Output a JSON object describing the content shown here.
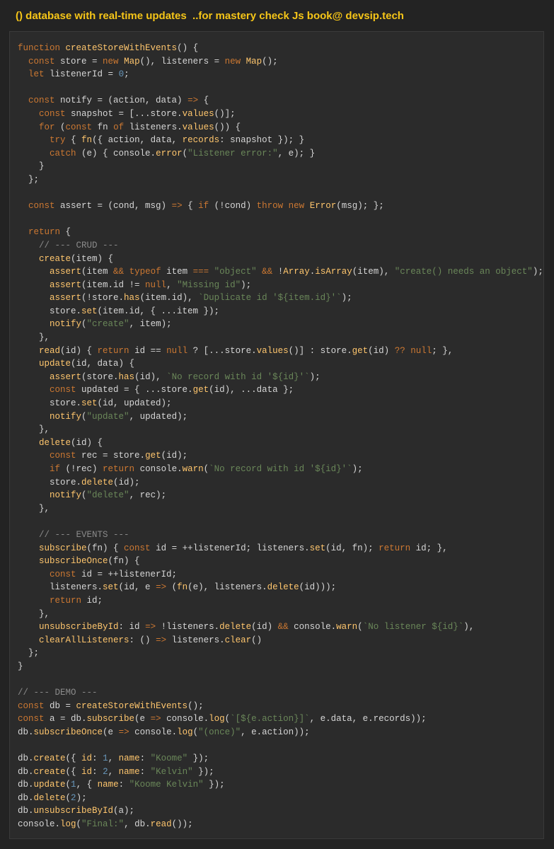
{
  "header": {
    "title": "() database with real-time updates  ..for mastery check Js book@ devsip.tech"
  },
  "code": {
    "language": "javascript",
    "lines": [
      "function createStoreWithEvents() {",
      "  const store = new Map(), listeners = new Map();",
      "  let listenerId = 0;",
      "",
      "  const notify = (action, data) => {",
      "    const snapshot = [...store.values()];",
      "    for (const fn of listeners.values()) {",
      "      try { fn({ action, data, records: snapshot }); }",
      "      catch (e) { console.error(\"Listener error:\", e); }",
      "    }",
      "  };",
      "",
      "  const assert = (cond, msg) => { if (!cond) throw new Error(msg); };",
      "",
      "  return {",
      "    // --- CRUD ---",
      "    create(item) {",
      "      assert(item && typeof item === \"object\" && !Array.isArray(item), \"create() needs an object\");",
      "      assert(item.id != null, \"Missing id\");",
      "      assert(!store.has(item.id), `Duplicate id '${item.id}'`);",
      "      store.set(item.id, { ...item });",
      "      notify(\"create\", item);",
      "    },",
      "    read(id) { return id == null ? [...store.values()] : store.get(id) ?? null; },",
      "    update(id, data) {",
      "      assert(store.has(id), `No record with id '${id}'`);",
      "      const updated = { ...store.get(id), ...data };",
      "      store.set(id, updated);",
      "      notify(\"update\", updated);",
      "    },",
      "    delete(id) {",
      "      const rec = store.get(id);",
      "      if (!rec) return console.warn(`No record with id '${id}'`);",
      "      store.delete(id);",
      "      notify(\"delete\", rec);",
      "    },",
      "",
      "    // --- EVENTS ---",
      "    subscribe(fn) { const id = ++listenerId; listeners.set(id, fn); return id; },",
      "    subscribeOnce(fn) {",
      "      const id = ++listenerId;",
      "      listeners.set(id, e => (fn(e), listeners.delete(id)));",
      "      return id;",
      "    },",
      "    unsubscribeById: id => !listeners.delete(id) && console.warn(`No listener ${id}`),",
      "    clearAllListeners: () => listeners.clear()",
      "  };",
      "}",
      "",
      "// --- DEMO ---",
      "const db = createStoreWithEvents();",
      "const a = db.subscribe(e => console.log(`[${e.action}]`, e.data, e.records));",
      "db.subscribeOnce(e => console.log(\"(once)\", e.action));",
      "",
      "db.create({ id: 1, name: \"Koome\" });",
      "db.create({ id: 2, name: \"Kelvin\" });",
      "db.update(1, { name: \"Koome Kelvin\" });",
      "db.delete(2);",
      "db.unsubscribeById(a);",
      "console.log(\"Final:\", db.read());"
    ]
  },
  "colors": {
    "page_background": "#232323",
    "panel_background": "#2b2b2b",
    "header_text": "#f5c518",
    "keyword": "#cc7832",
    "function": "#ffc66d",
    "string": "#6a8759",
    "number": "#6897bb",
    "comment": "#8a8a8a",
    "default_text": "#d6d6d6"
  }
}
